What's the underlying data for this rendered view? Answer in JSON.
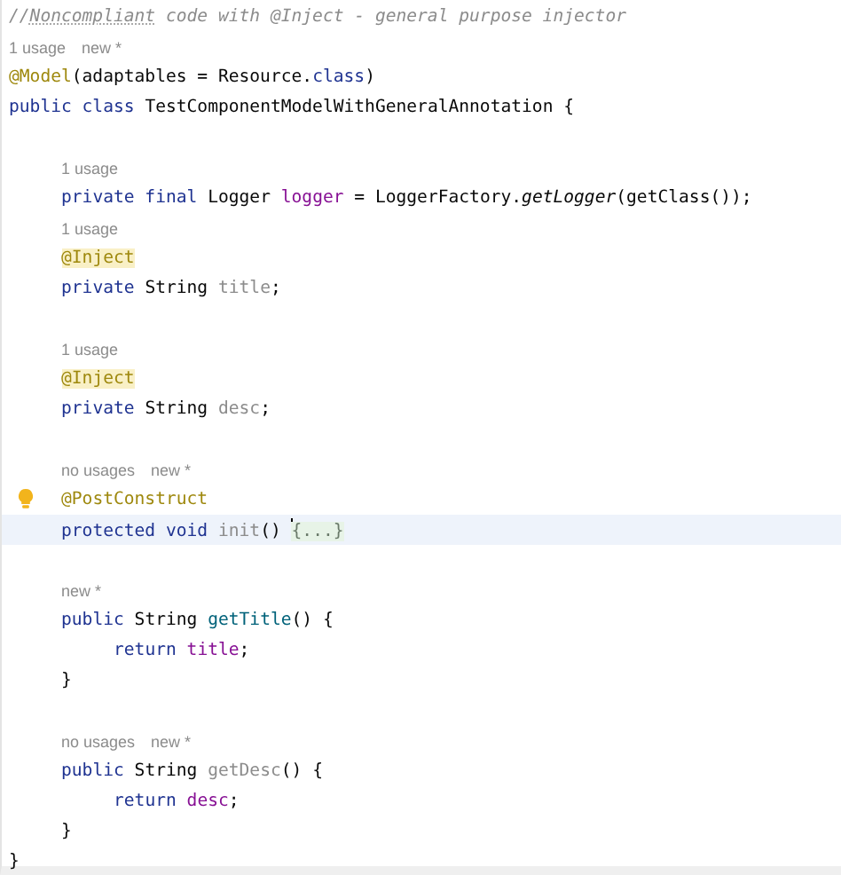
{
  "editor": {
    "code": [
      {
        "kind": "line",
        "current": false,
        "tokens": [
          {
            "kind": "comment",
            "s": "//"
          },
          {
            "kind": "typo",
            "s": "Noncompliant"
          },
          {
            "kind": "comment",
            "s": " code with @Inject - general purpose injector"
          }
        ]
      },
      {
        "kind": "hint",
        "parts": [
          "1 usage",
          "new *"
        ]
      },
      {
        "kind": "line",
        "current": false,
        "tokens": [
          {
            "kind": "annotation",
            "s": "@Model"
          },
          {
            "kind": "plain",
            "s": "(adaptables = Resource."
          },
          {
            "kind": "keyword",
            "s": "class"
          },
          {
            "kind": "plain",
            "s": ")"
          }
        ]
      },
      {
        "kind": "line",
        "current": false,
        "tokens": [
          {
            "kind": "keyword",
            "s": "public class "
          },
          {
            "kind": "plain",
            "s": "TestComponentModelWithGeneralAnnotation {"
          }
        ],
        "children": [
          {
            "kind": "blank"
          },
          {
            "kind": "hint",
            "parts": [
              "1 usage"
            ]
          },
          {
            "kind": "line",
            "current": false,
            "tokens": [
              {
                "kind": "keyword",
                "s": "private final "
              },
              {
                "kind": "plain",
                "s": "Logger "
              },
              {
                "kind": "field",
                "s": "logger"
              },
              {
                "kind": "plain",
                "s": " = LoggerFactory."
              },
              {
                "kind": "italic",
                "s": "getLogger"
              },
              {
                "kind": "plain",
                "s": "(getClass());"
              }
            ]
          },
          {
            "kind": "hint",
            "parts": [
              "1 usage"
            ]
          },
          {
            "kind": "line",
            "current": false,
            "tokens": [
              {
                "kind": "highlight",
                "s": "@Inject"
              }
            ]
          },
          {
            "kind": "line",
            "current": false,
            "tokens": [
              {
                "kind": "keyword",
                "s": "private "
              },
              {
                "kind": "plain",
                "s": "String "
              },
              {
                "kind": "unused",
                "s": "title"
              },
              {
                "kind": "plain",
                "s": ";"
              }
            ]
          },
          {
            "kind": "blank"
          },
          {
            "kind": "hint",
            "parts": [
              "1 usage"
            ]
          },
          {
            "kind": "line",
            "current": false,
            "tokens": [
              {
                "kind": "highlight",
                "s": "@Inject"
              }
            ]
          },
          {
            "kind": "line",
            "current": false,
            "tokens": [
              {
                "kind": "keyword",
                "s": "private "
              },
              {
                "kind": "plain",
                "s": "String "
              },
              {
                "kind": "unused",
                "s": "desc"
              },
              {
                "kind": "plain",
                "s": ";"
              }
            ]
          },
          {
            "kind": "blank"
          },
          {
            "kind": "hint",
            "parts": [
              "no usages",
              "new *"
            ]
          },
          {
            "kind": "line",
            "current": false,
            "bulb": true,
            "tokens": [
              {
                "kind": "annotation",
                "s": "@PostConstruct"
              }
            ]
          },
          {
            "kind": "line",
            "current": true,
            "caret": true,
            "tokens": [
              {
                "kind": "keyword",
                "s": "protected void "
              },
              {
                "kind": "unused",
                "s": "init"
              },
              {
                "kind": "plain",
                "s": "() "
              },
              {
                "kind": "fold",
                "s": "{...}"
              }
            ]
          },
          {
            "kind": "blank"
          },
          {
            "kind": "hint",
            "parts": [
              "new *"
            ]
          },
          {
            "kind": "line",
            "current": false,
            "tokens": [
              {
                "kind": "keyword",
                "s": "public "
              },
              {
                "kind": "plain",
                "s": "String "
              },
              {
                "kind": "method",
                "s": "getTitle"
              },
              {
                "kind": "plain",
                "s": "() {"
              }
            ],
            "children": [
              {
                "kind": "line",
                "current": false,
                "tokens": [
                  {
                    "kind": "keyword",
                    "s": "return "
                  },
                  {
                    "kind": "field",
                    "s": "title"
                  },
                  {
                    "kind": "plain",
                    "s": ";"
                  }
                ]
              }
            ]
          },
          {
            "kind": "line",
            "current": false,
            "tokens": [
              {
                "kind": "plain",
                "s": "}"
              }
            ]
          },
          {
            "kind": "blank"
          },
          {
            "kind": "hint",
            "parts": [
              "no usages",
              "new *"
            ]
          },
          {
            "kind": "line",
            "current": false,
            "tokens": [
              {
                "kind": "keyword",
                "s": "public "
              },
              {
                "kind": "plain",
                "s": "String "
              },
              {
                "kind": "unused",
                "s": "getDesc"
              },
              {
                "kind": "plain",
                "s": "() {"
              }
            ],
            "children": [
              {
                "kind": "line",
                "current": false,
                "tokens": [
                  {
                    "kind": "keyword",
                    "s": "return "
                  },
                  {
                    "kind": "field",
                    "s": "desc"
                  },
                  {
                    "kind": "plain",
                    "s": ";"
                  }
                ]
              }
            ]
          },
          {
            "kind": "line",
            "current": false,
            "tokens": [
              {
                "kind": "plain",
                "s": "}"
              }
            ]
          }
        ]
      },
      {
        "kind": "line",
        "current": false,
        "tokens": [
          {
            "kind": "plain",
            "s": "}"
          }
        ]
      }
    ]
  }
}
